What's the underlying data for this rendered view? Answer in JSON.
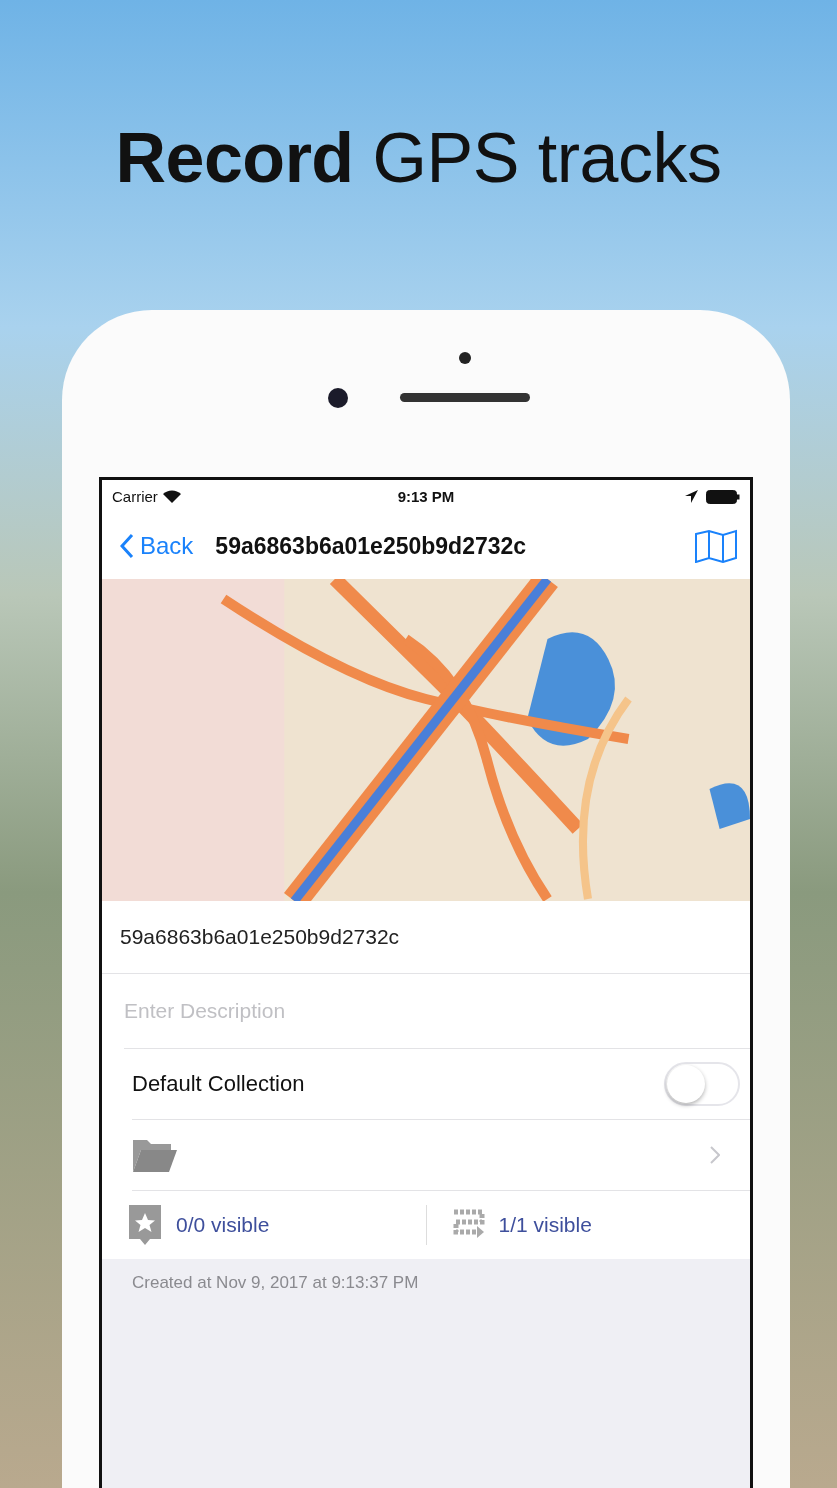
{
  "headline": "**Record** GPS tracks",
  "status_bar": {
    "carrier": "Carrier",
    "time": "9:13 PM"
  },
  "nav": {
    "back": "Back",
    "title": "59a6863b6a01e250b9d2732c"
  },
  "name_field": {
    "value": "59a6863b6a01e250b9d2732c"
  },
  "description_field": {
    "placeholder": "Enter Description"
  },
  "collection": {
    "label": "Default Collection",
    "on": false
  },
  "stats": [
    {
      "kind": "waypoints",
      "text": "0/0 visible"
    },
    {
      "kind": "tracks",
      "text": "1/1 visible"
    }
  ],
  "footer": "Created at Nov 9, 2017 at 9:13:37 PM"
}
